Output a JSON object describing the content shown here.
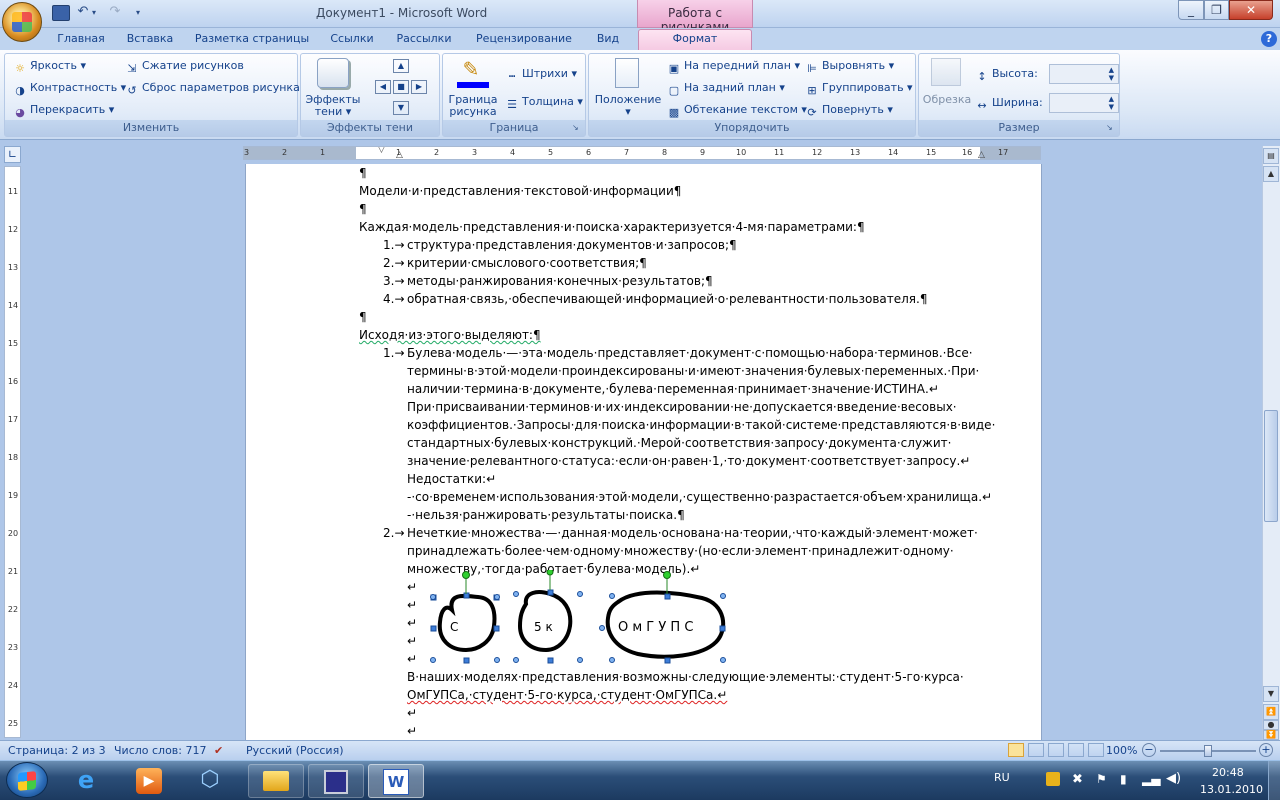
{
  "titlebar": {
    "title": "Документ1 - Microsoft Word",
    "context_group": "Работа с рисунками"
  },
  "tabs": [
    "Главная",
    "Вставка",
    "Разметка страницы",
    "Ссылки",
    "Рассылки",
    "Рецензирование",
    "Вид",
    "Формат"
  ],
  "ribbon": {
    "izmenit": {
      "label": "Изменить",
      "brightness": "Яркость",
      "contrast": "Контрастность",
      "recolor": "Перекрасить",
      "compress": "Сжатие рисунков",
      "reset": "Сброс параметров рисунка"
    },
    "shadow": {
      "label": "Эффекты тени",
      "button": "Эффекты тени"
    },
    "border": {
      "label": "Граница",
      "border_btn": "Граница рисунка",
      "dashes": "Штрихи",
      "weight": "Толщина"
    },
    "arrange": {
      "label": "Упорядочить",
      "position": "Положение",
      "front": "На передний план",
      "back": "На задний план",
      "wrap": "Обтекание текстом",
      "align": "Выровнять",
      "group": "Группировать",
      "rotate": "Повернуть"
    },
    "size": {
      "label": "Размер",
      "crop": "Обрезка",
      "height": "Высота:",
      "width": "Ширина:"
    }
  },
  "ruler": {
    "h_ticks": [
      "3",
      "2",
      "1",
      "",
      "1",
      "2",
      "3",
      "4",
      "5",
      "6",
      "7",
      "8",
      "9",
      "10",
      "11",
      "12",
      "13",
      "14",
      "15",
      "16",
      "17"
    ],
    "v_ticks": [
      "11",
      "12",
      "13",
      "14",
      "15",
      "16",
      "17",
      "18",
      "19",
      "20",
      "21",
      "22",
      "23",
      "24",
      "25"
    ]
  },
  "doc": {
    "p1": "¶",
    "p2": "Модели·и·представления·текстовой·информации¶",
    "p3": "¶",
    "p4": "Каждая·модель·представления·и·поиска·характеризуется·4-мя·параметрами:¶",
    "l1n": "1.→",
    "l1": "структура·представления·документов·и·запросов;¶",
    "l2n": "2.→",
    "l2": "критерии·смыслового·соответствия;¶",
    "l3n": "3.→",
    "l3": "методы·ранжирования·конечных·результатов;¶",
    "l4n": "4.→",
    "l4": "обратная·связь,·обеспечивающей·информацией·о·релевантности·пользователя.¶",
    "p5": "¶",
    "p6": "Исходя·из·этого·выделяют:¶",
    "b1n": "1.→",
    "b1a": "Булева·модель·—·эта·модель·представляет·документ·с·помощью·набора·терминов.·Все·",
    "b1b": "термины·в·этой·модели·проиндексированы·и·имеют·значения·булевых·переменных.·При·",
    "b1c": "наличии·термина·в·документе,·булева·переменная·принимает·значение·ИСТИНА.↵",
    "b1d": "При·присваивании·терминов·и·их·индексировании·не·допускается·введение·весовых·",
    "b1e": "коэффициентов.·Запросы·для·поиска·информации·в·такой·системе·представляются·в·виде·",
    "b1f": "стандартных·булевых·конструкций.·Мерой·соответствия·запросу·документа·служит·",
    "b1g": "значение·релевантного·статуса:·если·он·равен·1,·то·документ·соответствует·запросу.↵",
    "b1h": "Недостатки:↵",
    "b1i": "-·со·временем·использования·этой·модели,·существенно·разрастается·объем·хранилища.↵",
    "b1j": "-·нельзя·ранжировать·результаты·поиска.¶",
    "b2n": "2.→",
    "b2a": "Нечеткие·множества·—·данная·модель·основана·на·теории,·что·каждый·элемент·может·",
    "b2b": "принадлежать·более·чем·одному·множеству·(но·если·элемент·принадлежит·одному·",
    "b2c": "множеству,·тогда·работает·булева·модель).↵",
    "br": "↵",
    "c1": "С",
    "c2": "5 к",
    "c3": "О м Г У П С",
    "t1": "В·наших·моделях·представления·возможны·следующие·элементы:·студент·5-го·курса·",
    "t2": "ОмГУПСа,·студент·5-го·курса,·студент·ОмГУПСа.↵"
  },
  "status": {
    "page": "Страница: 2 из 3",
    "words": "Число слов: 717",
    "lang": "Русский (Россия)",
    "zoom": "100%"
  },
  "tray": {
    "lang": "RU",
    "time": "20:48",
    "date": "13.01.2010"
  }
}
